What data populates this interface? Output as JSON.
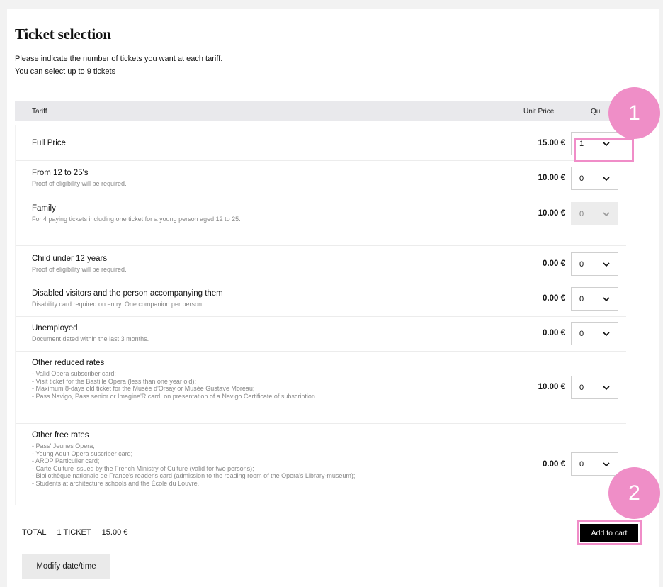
{
  "page": {
    "title": "Ticket selection",
    "intro_line1": "Please indicate the number of tickets you want at each tariff.",
    "intro_line2": "You can select up to 9 tickets"
  },
  "table": {
    "headers": {
      "tariff": "Tariff",
      "unit_price": "Unit Price",
      "quantity": "Qu"
    },
    "rows": [
      {
        "name": "Full Price",
        "description": "",
        "price": "15.00 €",
        "quantity": "1",
        "disabled": false
      },
      {
        "name": "From 12 to 25's",
        "description": "Proof of eligibility will be required.",
        "price": "10.00 €",
        "quantity": "0",
        "disabled": false
      },
      {
        "name": "Family",
        "description": "For 4 paying tickets including one ticket for a young person aged 12 to 25.",
        "price": "10.00 €",
        "quantity": "0",
        "disabled": true
      },
      {
        "name": "Child under 12 years",
        "description": "Proof of eligibility will be required.",
        "price": "0.00 €",
        "quantity": "0",
        "disabled": false
      },
      {
        "name": "Disabled visitors and the person accompanying them",
        "description": "Disability card required on entry. One companion per person.",
        "price": "0.00 €",
        "quantity": "0",
        "disabled": false
      },
      {
        "name": "Unemployed",
        "description": "Document dated within the last 3 months.",
        "price": "0.00 €",
        "quantity": "0",
        "disabled": false
      },
      {
        "name": "Other reduced rates",
        "description": "- Valid Opera subscriber card;\n- Visit ticket for the Bastille Opera (less than one year old);\n- Maximum 8-days old ticket for the Musée d'Orsay or Musée Gustave Moreau;\n- Pass Navigo, Pass senior or Imagine'R card, on presentation of a Navigo Certificate of subscription.",
        "price": "10.00 €",
        "quantity": "0",
        "disabled": false
      },
      {
        "name": "Other free rates",
        "description": "- Pass' Jeunes Opera;\n- Young Adult Opera suscriber card;\n- AROP Particulier card;\n- Carte Culture issued by the French Ministry of Culture (valid for two persons);\n- Bibliothèque nationale de France's reader's card (admission to the reading room of the Opera's Library-museum);\n- Students at architecture schools and the École du Louvre.",
        "price": "0.00 €",
        "quantity": "0",
        "disabled": false
      }
    ]
  },
  "summary": {
    "total_label": "TOTAL",
    "tickets": "1 TICKET",
    "amount": "15.00 €"
  },
  "buttons": {
    "add_to_cart": "Add to cart",
    "modify": "Modify date/time"
  },
  "annotations": {
    "badge1": "1",
    "badge2": "2",
    "color": "#ef8ec7"
  }
}
